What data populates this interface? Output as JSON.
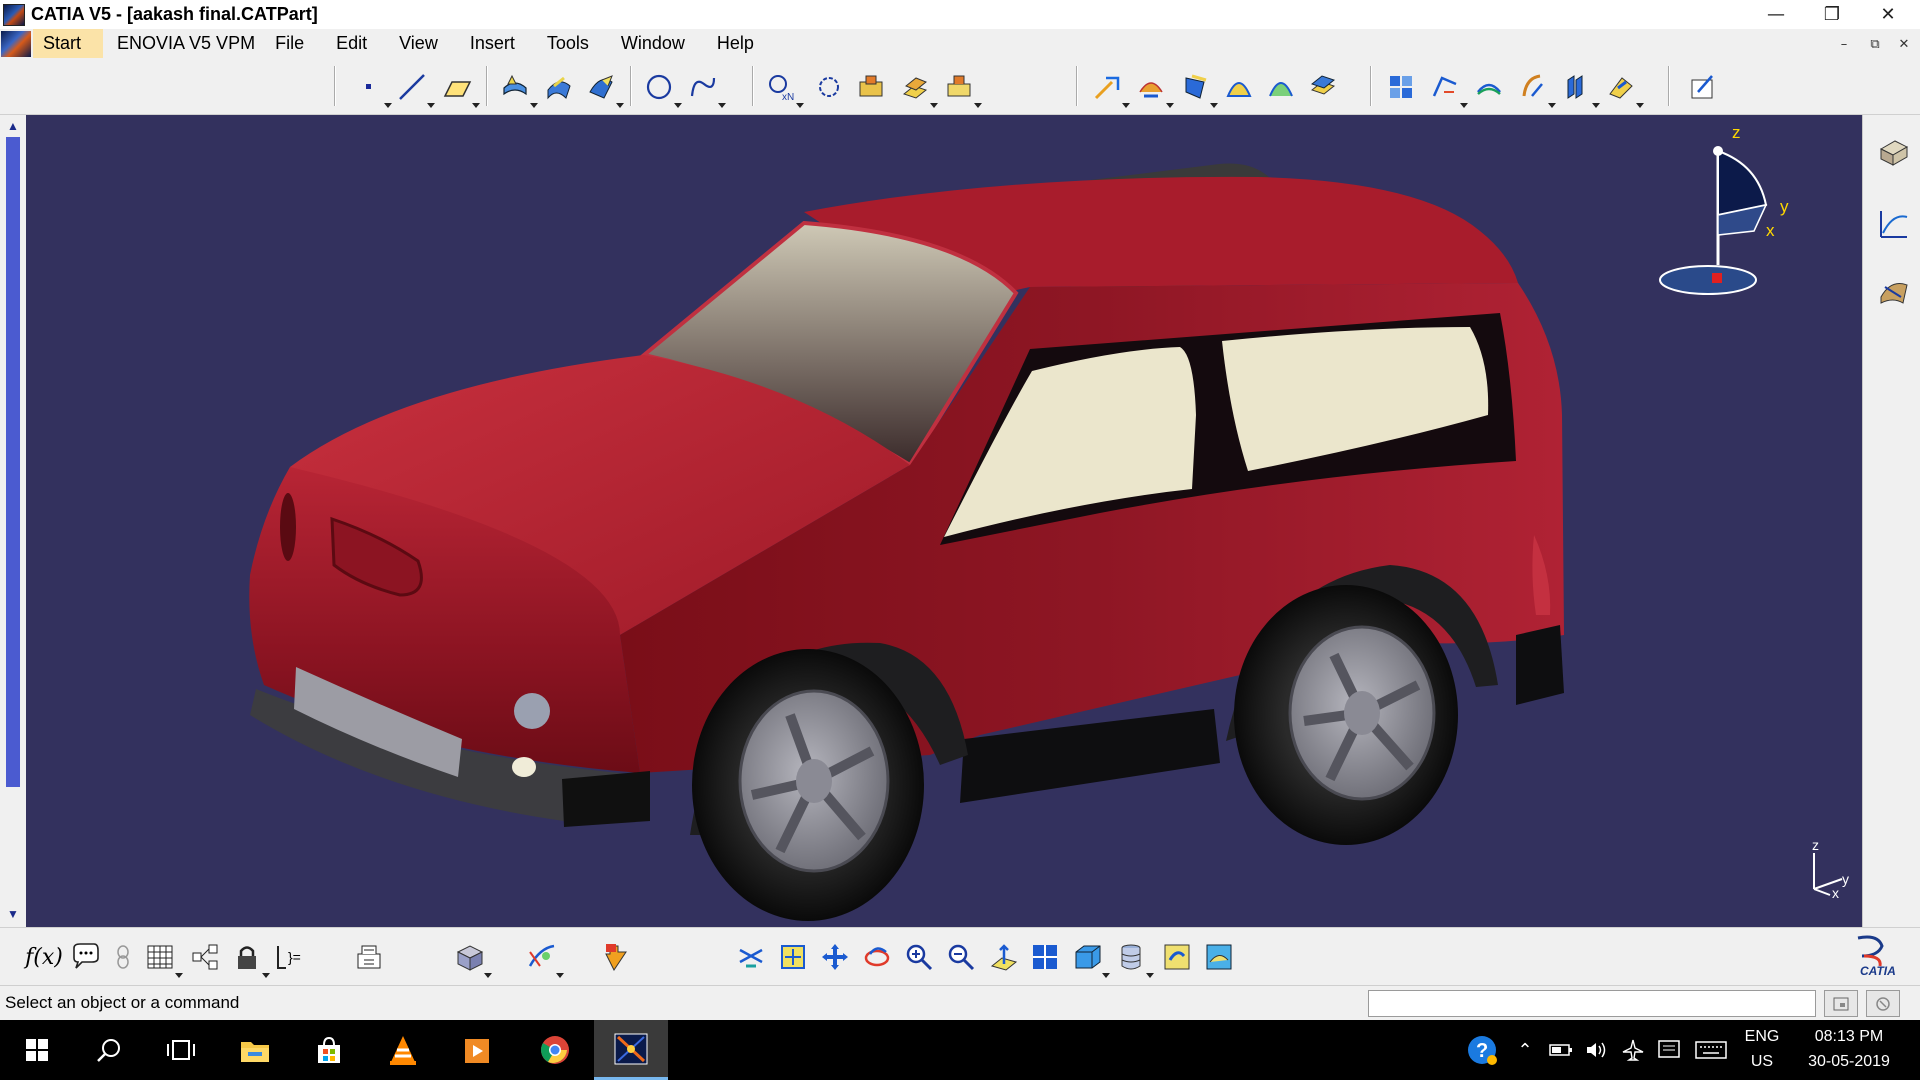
{
  "window": {
    "title": "CATIA V5 - [aakash final.CATPart]",
    "minimize_glyph": "—",
    "restore_glyph": "❐",
    "close_glyph": "✕"
  },
  "menubar": {
    "items": [
      {
        "label": "Start"
      },
      {
        "label": "ENOVIA V5 VPM"
      },
      {
        "label": "File"
      },
      {
        "label": "Edit"
      },
      {
        "label": "View"
      },
      {
        "label": "Insert"
      },
      {
        "label": "Tools"
      },
      {
        "label": "Window"
      },
      {
        "label": "Help"
      }
    ],
    "doc_minimize_glyph": "–",
    "doc_restore_glyph": "⧉",
    "doc_close_glyph": "✕"
  },
  "toolbar_top": {
    "icons": [
      "point-icon",
      "line-icon",
      "plane-icon",
      "extrude-surface-icon",
      "offset-surface-icon",
      "fill-surface-icon",
      "circle-icon",
      "spline-icon",
      "intersection-icon",
      "boundary-icon",
      "join-icon",
      "split-icon",
      "trim-icon",
      "fillet-surface-icon",
      "shape-fillet-icon",
      "edge-fillet-icon",
      "variable-fillet-icon",
      "chordal-fillet-icon",
      "translate-icon",
      "transform-icon",
      "rotate-icon",
      "symmetry-icon",
      "scale-icon",
      "affinity-icon",
      "extrapolate-icon",
      "sketcher-icon"
    ]
  },
  "toolbar_bottom": {
    "formula_label": "f(x)",
    "icons": [
      "comment-icon",
      "knowledge-icon",
      "table-icon",
      "parameters-icon",
      "lock-icon",
      "measure-icon",
      "publish-icon",
      "render-icon",
      "apply-material-icon",
      "snap-icon",
      "fly-icon",
      "fit-all-icon",
      "pan-icon",
      "rotate-view-icon",
      "zoom-in-icon",
      "zoom-out-icon",
      "normal-view-icon",
      "multi-view-icon",
      "isometric-view-icon",
      "hide-show-icon",
      "swap-space-icon",
      "shading-icon"
    ],
    "brand_label": "CATIA"
  },
  "compass": {
    "z_label": "z",
    "y_label": "y",
    "x_label": "x"
  },
  "mini_axis": {
    "z_label": "z",
    "y_label": "y",
    "x_label": "x"
  },
  "status": {
    "text": "Select an object or a command",
    "command_input_value": ""
  },
  "taskbar": {
    "apps": [
      "windows-start-icon",
      "search-icon",
      "task-view-icon",
      "file-explorer-icon",
      "store-icon",
      "vlc-icon",
      "media-player-icon",
      "chrome-icon",
      "catia-icon"
    ],
    "language_line1": "ENG",
    "language_line2": "US",
    "time": "08:13 PM",
    "date": "30-05-2019"
  },
  "colors": {
    "viewport_bg": "#33315e",
    "car_body": "#8a1220",
    "window_glass": "#eae5c8",
    "menu_start_highlight": "#fbe3a8"
  }
}
